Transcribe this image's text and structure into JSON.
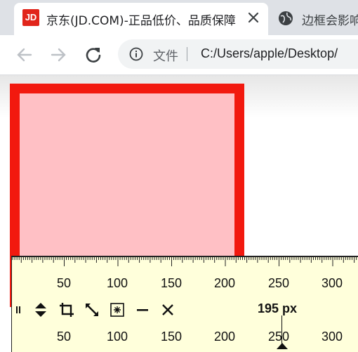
{
  "tabs": [
    {
      "title": "京东(JD.COM)-正品低价、品质保障",
      "favicon": "JD"
    },
    {
      "title": "边框会影响盒子"
    }
  ],
  "toolbar": {
    "scheme_label": "文件",
    "url": "C:/Users/apple/Desktop/"
  },
  "ruler": {
    "scale_top": [
      "50",
      "100",
      "150",
      "200",
      "250",
      "300"
    ],
    "scale_bottom": [
      "50",
      "100",
      "150",
      "200",
      "250",
      "300"
    ],
    "measurement": "195 px"
  },
  "colors": {
    "box_border": "#f2190f",
    "box_fill": "#ffc0c5",
    "ruler_bg": "#ffffdb"
  }
}
